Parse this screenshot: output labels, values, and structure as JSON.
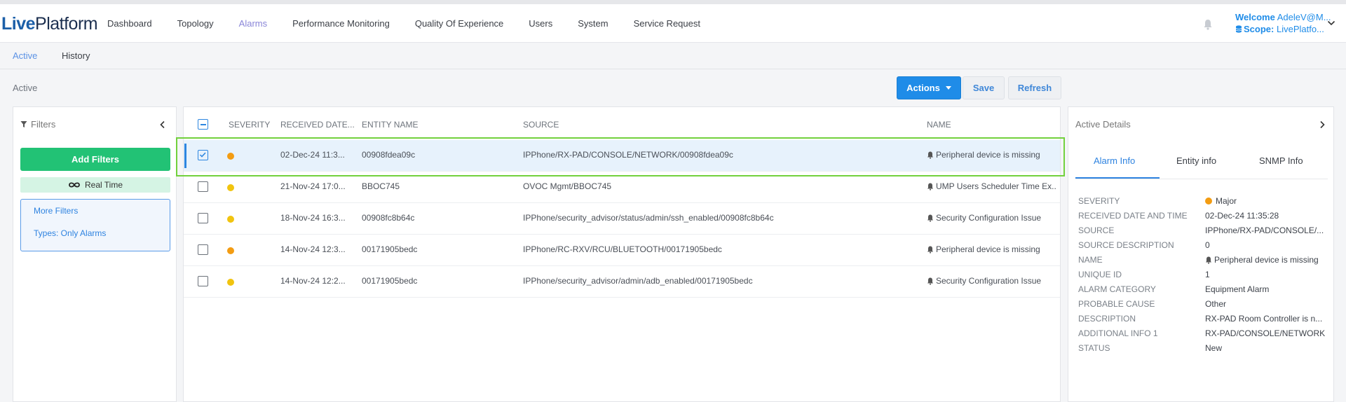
{
  "app": {
    "logo": {
      "part1": "Live",
      "part2": "Platform"
    },
    "nav": [
      {
        "label": "Dashboard",
        "active": false
      },
      {
        "label": "Topology",
        "active": false
      },
      {
        "label": "Alarms",
        "active": true
      },
      {
        "label": "Performance Monitoring",
        "active": false
      },
      {
        "label": "Quality Of Experience",
        "active": false
      },
      {
        "label": "Users",
        "active": false
      },
      {
        "label": "System",
        "active": false
      },
      {
        "label": "Service Request",
        "active": false
      }
    ],
    "user": {
      "welcome_label": "Welcome",
      "welcome_value": "AdeleV@M...",
      "scope_label": "Scope:",
      "scope_value": "LivePlatfo..."
    }
  },
  "subtabs": [
    {
      "label": "Active",
      "active": true
    },
    {
      "label": "History",
      "active": false
    }
  ],
  "page": {
    "title": "Active",
    "actions_label": "Actions",
    "save_label": "Save",
    "refresh_label": "Refresh"
  },
  "filters": {
    "title": "Filters",
    "add_label": "Add Filters",
    "realtime_label": "Real Time",
    "more_filters": "More Filters",
    "types_filter": "Types: Only Alarms"
  },
  "table": {
    "columns": [
      "SEVERITY",
      "RECEIVED DATE...",
      "ENTITY NAME",
      "SOURCE",
      "NAME"
    ],
    "rows": [
      {
        "selected": true,
        "severity_color": "#f39c12",
        "date": "02-Dec-24 11:3...",
        "entity": "00908fdea09c",
        "source": "IPPhone/RX-PAD/CONSOLE/NETWORK/00908fdea09c",
        "name": "Peripheral device is missing"
      },
      {
        "selected": false,
        "severity_color": "#f1c40f",
        "date": "21-Nov-24 17:0...",
        "entity": "BBOC745",
        "source": "OVOC Mgmt/BBOC745",
        "name": "UMP Users Scheduler Time Ex..."
      },
      {
        "selected": false,
        "severity_color": "#f1c40f",
        "date": "18-Nov-24 16:3...",
        "entity": "00908fc8b64c",
        "source": "IPPhone/security_advisor/status/admin/ssh_enabled/00908fc8b64c",
        "name": "Security Configuration Issue"
      },
      {
        "selected": false,
        "severity_color": "#f39c12",
        "date": "14-Nov-24 12:3...",
        "entity": "00171905bedc",
        "source": "IPPhone/RC-RXV/RCU/BLUETOOTH/00171905bedc",
        "name": "Peripheral device is missing"
      },
      {
        "selected": false,
        "severity_color": "#f1c40f",
        "date": "14-Nov-24 12:2...",
        "entity": "00171905bedc",
        "source": "IPPhone/security_advisor/admin/adb_enabled/00171905bedc",
        "name": "Security Configuration Issue"
      }
    ]
  },
  "details": {
    "title": "Active Details",
    "tabs": [
      {
        "label": "Alarm Info",
        "active": true
      },
      {
        "label": "Entity info",
        "active": false
      },
      {
        "label": "SNMP Info",
        "active": false
      }
    ],
    "fields": [
      {
        "key": "SEVERITY",
        "value": "Major"
      },
      {
        "key": "RECEIVED DATE AND TIME",
        "value": "02-Dec-24 11:35:28"
      },
      {
        "key": "SOURCE",
        "value": "IPPhone/RX-PAD/CONSOLE/..."
      },
      {
        "key": "SOURCE DESCRIPTION",
        "value": "0"
      },
      {
        "key": "NAME",
        "value": "Peripheral device is missing"
      },
      {
        "key": "UNIQUE ID",
        "value": "1"
      },
      {
        "key": "ALARM CATEGORY",
        "value": "Equipment Alarm"
      },
      {
        "key": "PROBABLE CAUSE",
        "value": "Other"
      },
      {
        "key": "DESCRIPTION",
        "value": "RX-PAD Room Controller is n..."
      },
      {
        "key": "ADDITIONAL INFO 1",
        "value": "RX-PAD/CONSOLE/NETWORK"
      },
      {
        "key": "STATUS",
        "value": "New"
      }
    ]
  },
  "colors": {
    "accent": "#1f8ce8",
    "add_filters": "#22c275",
    "selected_row": "#e7f2fc",
    "highlight_frame": "#72d13d",
    "major": "#f39c12",
    "minor": "#f1c40f"
  }
}
